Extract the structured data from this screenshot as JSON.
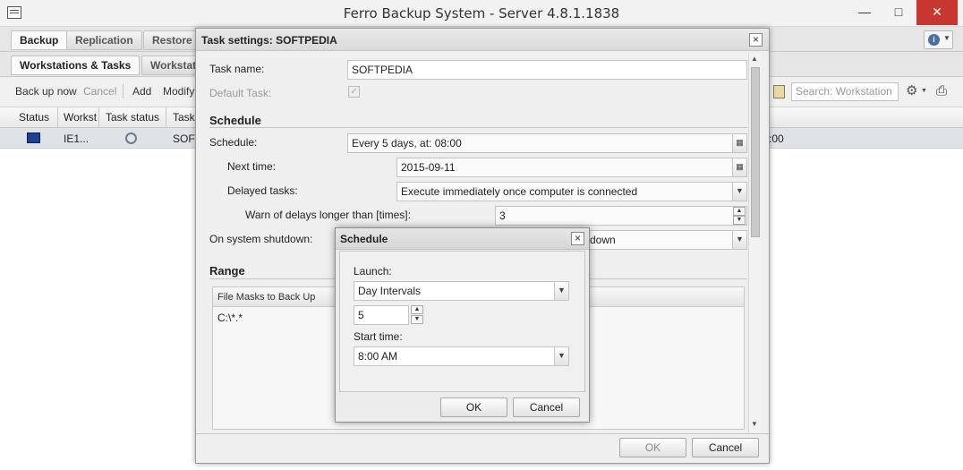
{
  "window": {
    "title": "Ferro Backup System - Server 4.8.1.1838"
  },
  "tabs_top": [
    "Backup",
    "Replication",
    "Restore"
  ],
  "tabs_sub": [
    "Workstations & Tasks",
    "Workstat"
  ],
  "toolbar": {
    "back_up_now": "Back up now",
    "cancel": "Cancel",
    "add": "Add",
    "modify": "Modify",
    "search_placeholder": "Search: Workstation"
  },
  "grid": {
    "columns": [
      "Status",
      "Workst",
      "Task status",
      "Task"
    ],
    "row": {
      "workstation": "IE1...",
      "task": "SOFT",
      "right_text": ":00"
    }
  },
  "task_dialog": {
    "title": "Task settings: SOFTPEDIA",
    "task_name_label": "Task name:",
    "task_name_value": "SOFTPEDIA",
    "default_task_label": "Default Task:",
    "schedule_section": "Schedule",
    "schedule_label": "Schedule:",
    "schedule_value": "Every 5 days, at: 08:00",
    "next_time_label": "Next time:",
    "next_time_value": "2015-09-11",
    "delayed_label": "Delayed tasks:",
    "delayed_value": "Execute immediately once computer is connected",
    "warn_label": "Warn of delays longer than [times]:",
    "warn_value": "3",
    "shutdown_label": "On system shutdown:",
    "shutdown_value": "down",
    "range_section": "Range",
    "file_masks_header": "File Masks to Back Up",
    "file_mask_value": "C:\\*.*",
    "ok": "OK",
    "cancel": "Cancel"
  },
  "schedule_dialog": {
    "title": "Schedule",
    "launch_label": "Launch:",
    "launch_value": "Day Intervals",
    "interval_value": "5",
    "start_time_label": "Start time:",
    "start_time_value": "8:00 AM",
    "ok": "OK",
    "cancel": "Cancel"
  }
}
